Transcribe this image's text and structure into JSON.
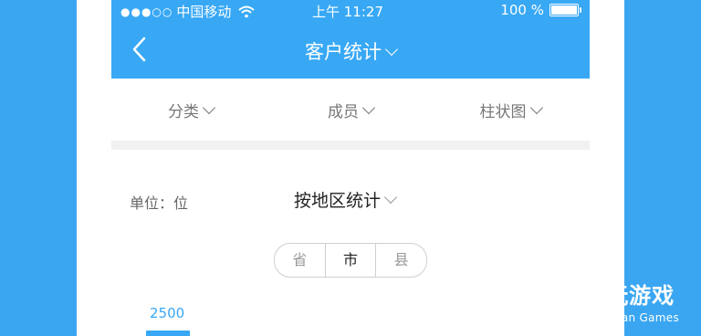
{
  "status_bar": {
    "carrier": "中国移动",
    "time": "上午 11:27",
    "battery": "100 %"
  },
  "header": {
    "title": "客户统计"
  },
  "filters": [
    {
      "label": "分类"
    },
    {
      "label": "成员"
    },
    {
      "label": "柱状图"
    }
  ],
  "content": {
    "unit_label": "单位：位",
    "group_title": "按地区统计",
    "segments": [
      {
        "label": "省"
      },
      {
        "label": "市"
      },
      {
        "label": "县"
      }
    ],
    "selected_segment": "市",
    "y_tick": "2500"
  },
  "watermark": {
    "main": "仍玩游戏",
    "sub": "Rengwan Games"
  }
}
